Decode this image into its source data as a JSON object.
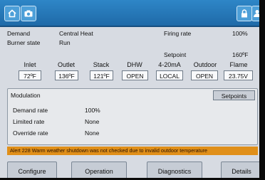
{
  "icons": {
    "home": "home-icon",
    "camera": "camera-icon",
    "lock": "lock-icon",
    "user": "user-icon"
  },
  "status": {
    "demand_label": "Demand",
    "demand_value": "Central Heat",
    "burner_label": "Burner state",
    "burner_value": "Run",
    "firing_label": "Firing rate",
    "firing_value": "100%",
    "setpoint_label": "Setpoint",
    "setpoint_value": "160ºF"
  },
  "sensors": {
    "inlet": {
      "label": "Inlet",
      "value": "72ºF"
    },
    "outlet": {
      "label": "Outlet",
      "value": "136ºF"
    },
    "stack": {
      "label": "Stack",
      "value": "121ºF"
    },
    "dhw": {
      "label": "DHW",
      "value": "OPEN"
    },
    "ma": {
      "label": "4-20mA",
      "value": "LOCAL"
    },
    "outdoor": {
      "label": "Outdoor",
      "value": "OPEN"
    },
    "flame": {
      "label": "Flame",
      "value": "23.75V"
    }
  },
  "modulation": {
    "title": "Modulation",
    "setpoints_button": "Setpoints",
    "demand_label": "Demand rate",
    "demand_value": "100%",
    "limited_label": "Limited rate",
    "limited_value": "None",
    "override_label": "Override rate",
    "override_value": "None"
  },
  "alert": "Alert 228 Warm weather shutdown was not checked due to invalid outdoor temperature",
  "nav": {
    "configure": "Configure",
    "operation": "Operation",
    "diagnostics": "Diagnostics",
    "details": "Details"
  },
  "colors": {
    "title_bar": "#2679bb",
    "alert": "#e08f19",
    "screen_bg": "#d7dbe2"
  }
}
